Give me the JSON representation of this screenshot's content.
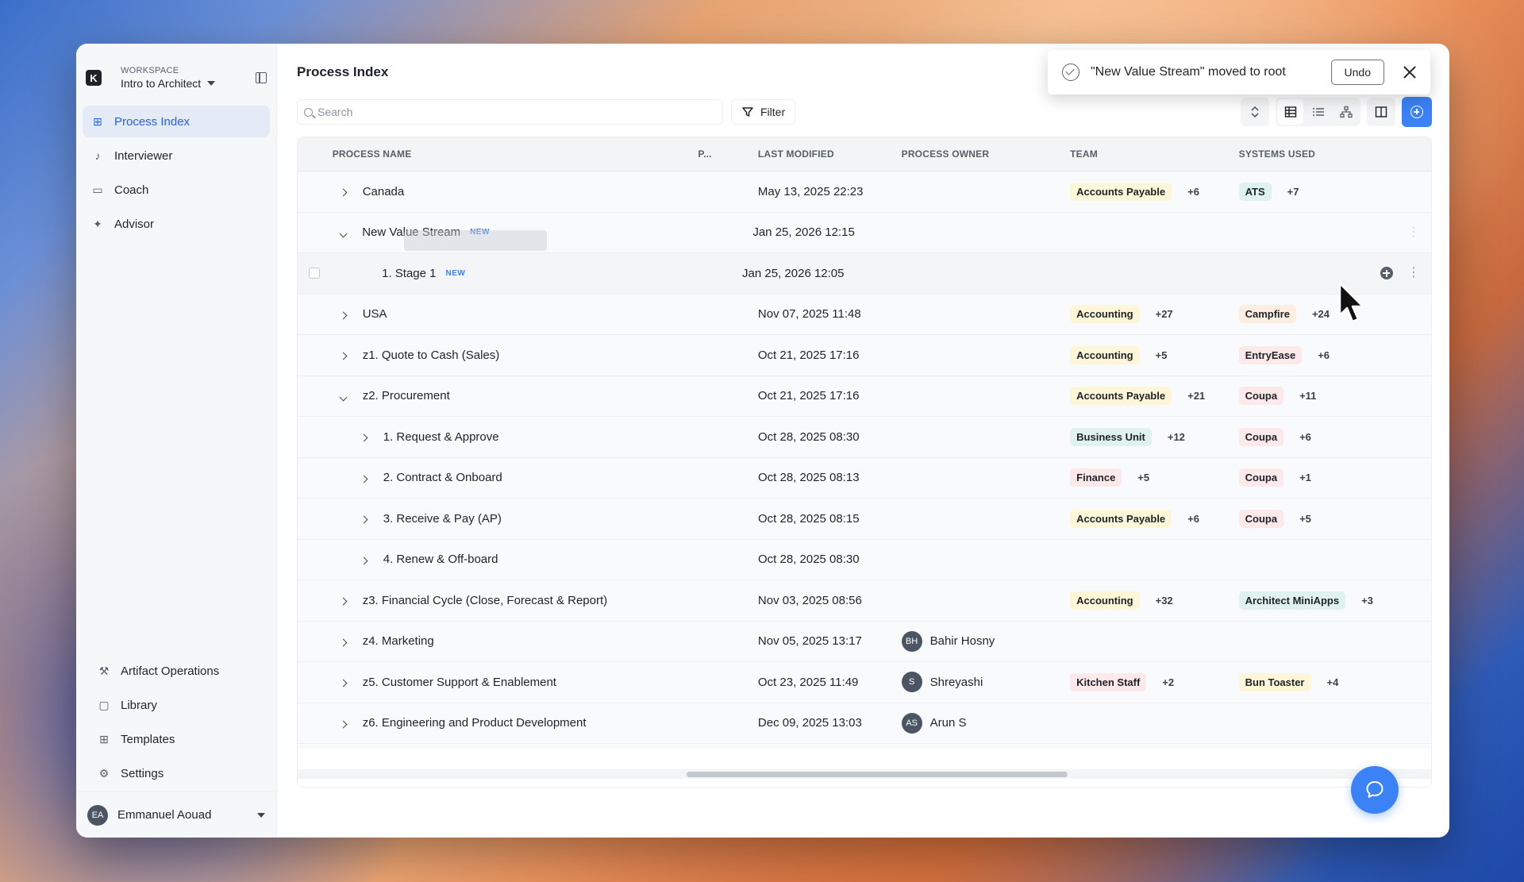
{
  "workspace": {
    "label": "WORKSPACE",
    "name": "Intro to Architect",
    "logo": "K"
  },
  "nav": {
    "top": [
      {
        "label": "Process Index",
        "icon": "process-tree-icon",
        "active": true
      },
      {
        "label": "Interviewer",
        "icon": "mic-icon",
        "active": false
      },
      {
        "label": "Coach",
        "icon": "chat-icon",
        "active": false
      },
      {
        "label": "Advisor",
        "icon": "sparkle-icon",
        "active": false
      }
    ],
    "bottom": [
      {
        "label": "Artifact Operations",
        "icon": "artifact-icon"
      },
      {
        "label": "Library",
        "icon": "folder-icon"
      },
      {
        "label": "Templates",
        "icon": "grid-icon"
      },
      {
        "label": "Settings",
        "icon": "gear-icon"
      }
    ]
  },
  "user": {
    "initials": "EA",
    "name": "Emmanuel Aouad"
  },
  "page": {
    "title": "Process Index"
  },
  "toolbar": {
    "search_placeholder": "Search",
    "filter_label": "Filter"
  },
  "toast": {
    "message": "\"New Value Stream\" moved to root",
    "undo_label": "Undo"
  },
  "columns": {
    "name": "PROCESS NAME",
    "p": "P...",
    "modified": "LAST MODIFIED",
    "owner": "PROCESS OWNER",
    "team": "TEAM",
    "systems": "SYSTEMS USED"
  },
  "rows": [
    {
      "name": "Canada",
      "level": 0,
      "expanded": false,
      "new": "",
      "modified": "May 13, 2025 22:23",
      "owner_initials": "",
      "owner": "",
      "team": "Accounts Payable",
      "team_color": "yellow",
      "team_more": "+6",
      "system": "ATS",
      "system_color": "teal",
      "system_more": "+7"
    },
    {
      "name": "New Value Stream",
      "level": 0,
      "expanded": true,
      "new": "NEW",
      "modified": "Jan 25, 2026 12:15",
      "owner_initials": "",
      "owner": "",
      "team": "",
      "team_color": "",
      "team_more": "",
      "system": "",
      "system_color": "",
      "system_more": ""
    },
    {
      "name": "1. Stage 1",
      "level": 1,
      "expanded": null,
      "new": "NEW",
      "modified": "Jan 25, 2026 12:05",
      "owner_initials": "",
      "owner": "",
      "team": "",
      "team_color": "",
      "team_more": "",
      "system": "",
      "system_color": "",
      "system_more": ""
    },
    {
      "name": "USA",
      "level": 0,
      "expanded": false,
      "new": "",
      "modified": "Nov 07, 2025 11:48",
      "owner_initials": "",
      "owner": "",
      "team": "Accounting",
      "team_color": "yellow",
      "team_more": "+27",
      "system": "Campfire",
      "system_color": "orange",
      "system_more": "+24"
    },
    {
      "name": "z1. Quote to Cash (Sales)",
      "level": 0,
      "expanded": false,
      "new": "",
      "modified": "Oct 21, 2025 17:16",
      "owner_initials": "",
      "owner": "",
      "team": "Accounting",
      "team_color": "yellow",
      "team_more": "+5",
      "system": "EntryEase",
      "system_color": "pink",
      "system_more": "+6"
    },
    {
      "name": "z2. Procurement",
      "level": 0,
      "expanded": true,
      "new": "",
      "modified": "Oct 21, 2025 17:16",
      "owner_initials": "",
      "owner": "",
      "team": "Accounts Payable",
      "team_color": "yellow",
      "team_more": "+21",
      "system": "Coupa",
      "system_color": "pink",
      "system_more": "+11"
    },
    {
      "name": "1. Request & Approve",
      "level": 1,
      "expanded": false,
      "new": "",
      "modified": "Oct 28, 2025 08:30",
      "owner_initials": "",
      "owner": "",
      "team": "Business Unit",
      "team_color": "teal",
      "team_more": "+12",
      "system": "Coupa",
      "system_color": "pink",
      "system_more": "+6"
    },
    {
      "name": "2. Contract & Onboard",
      "level": 1,
      "expanded": false,
      "new": "",
      "modified": "Oct 28, 2025 08:13",
      "owner_initials": "",
      "owner": "",
      "team": "Finance",
      "team_color": "pink",
      "team_more": "+5",
      "system": "Coupa",
      "system_color": "pink",
      "system_more": "+1"
    },
    {
      "name": "3. Receive & Pay (AP)",
      "level": 1,
      "expanded": false,
      "new": "",
      "modified": "Oct 28, 2025 08:15",
      "owner_initials": "",
      "owner": "",
      "team": "Accounts Payable",
      "team_color": "yellow",
      "team_more": "+6",
      "system": "Coupa",
      "system_color": "pink",
      "system_more": "+5"
    },
    {
      "name": "4. Renew & Off-board",
      "level": 1,
      "expanded": false,
      "new": "",
      "modified": "Oct 28, 2025 08:30",
      "owner_initials": "",
      "owner": "",
      "team": "",
      "team_color": "",
      "team_more": "",
      "system": "",
      "system_color": "",
      "system_more": ""
    },
    {
      "name": "z3. Financial Cycle (Close, Forecast & Report)",
      "level": 0,
      "expanded": false,
      "new": "",
      "modified": "Nov 03, 2025 08:56",
      "owner_initials": "",
      "owner": "",
      "team": "Accounting",
      "team_color": "yellow",
      "team_more": "+32",
      "system": "Architect MiniApps",
      "system_color": "teal",
      "system_more": "+3"
    },
    {
      "name": "z4. Marketing",
      "level": 0,
      "expanded": false,
      "new": "",
      "modified": "Nov 05, 2025 13:17",
      "owner_initials": "BH",
      "owner": "Bahir Hosny",
      "team": "",
      "team_color": "",
      "team_more": "",
      "system": "",
      "system_color": "",
      "system_more": ""
    },
    {
      "name": "z5. Customer Support & Enablement",
      "level": 0,
      "expanded": false,
      "new": "",
      "modified": "Oct 23, 2025 11:49",
      "owner_initials": "S",
      "owner": "Shreyashi",
      "team": "Kitchen Staff",
      "team_color": "pink",
      "team_more": "+2",
      "system": "Bun Toaster",
      "system_color": "yellow",
      "system_more": "+4"
    },
    {
      "name": "z6. Engineering and Product Development",
      "level": 0,
      "expanded": false,
      "new": "",
      "modified": "Dec 09, 2025 13:03",
      "owner_initials": "AS",
      "owner": "Arun S",
      "team": "",
      "team_color": "",
      "team_more": "",
      "system": "",
      "system_color": "",
      "system_more": ""
    }
  ],
  "colors": {
    "accent": "#3b82f6",
    "active_nav_bg": "#e4ebf7"
  }
}
